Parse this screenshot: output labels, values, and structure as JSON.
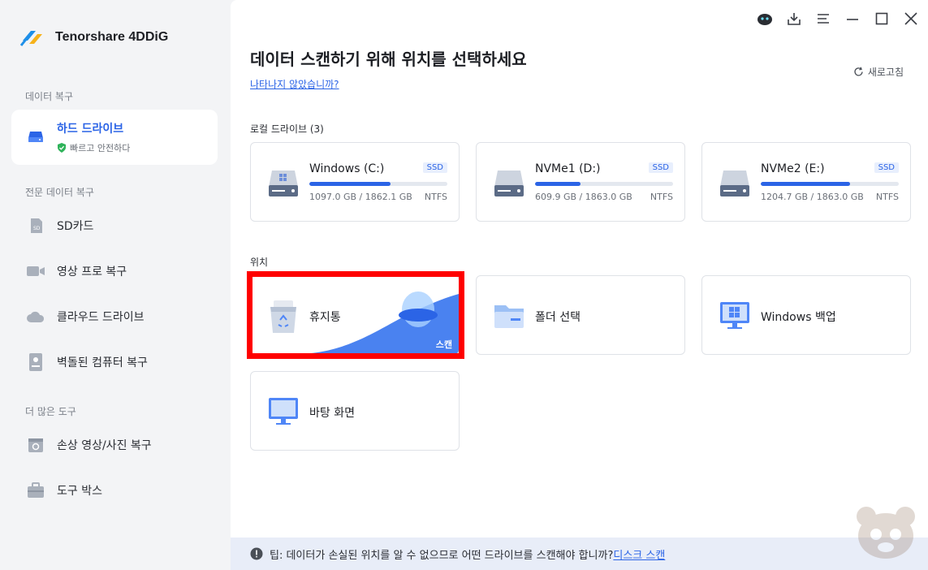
{
  "app": {
    "brand": "Tenorshare 4DDiG"
  },
  "sidebar": {
    "sections": [
      {
        "title": "데이터 복구"
      },
      {
        "title": "전문 데이터 복구"
      },
      {
        "title": "더 많은 도구"
      }
    ],
    "items": [
      {
        "label": "하드 드라이브",
        "sub": "빠르고 안전하다",
        "icon": "hard-drive-icon",
        "active": true
      },
      {
        "label": "SD카드",
        "icon": "sd-card-icon"
      },
      {
        "label": "영상 프로 복구",
        "icon": "video-camera-icon"
      },
      {
        "label": "클라우드 드라이브",
        "icon": "cloud-icon"
      },
      {
        "label": "벽돌된 컴퓨터 복구",
        "icon": "crashed-pc-icon"
      },
      {
        "label": "손상 영상/사진 복구",
        "icon": "photo-repair-icon"
      },
      {
        "label": "도구 박스",
        "icon": "toolbox-icon"
      }
    ]
  },
  "window_controls": [
    "assistant-icon",
    "download-icon",
    "menu-icon",
    "minimize-icon",
    "maximize-icon",
    "close-icon"
  ],
  "main": {
    "title": "데이터 스캔하기 위해 위치를 선택하세요",
    "help_link": "나타나지 않았습니까?",
    "refresh": "새로고침",
    "local_drives_label": "로컬 드라이브 (3)",
    "drives": [
      {
        "name": "Windows (C:)",
        "type": "SSD",
        "used": "1097.0 GB",
        "total": "1862.1 GB",
        "size_text": "1097.0 GB / 1862.1 GB",
        "fs": "NTFS",
        "usage": 0.589
      },
      {
        "name": "NVMe1 (D:)",
        "type": "SSD",
        "used": "609.9 GB",
        "total": "1863.0 GB",
        "size_text": "609.9 GB / 1863.0 GB",
        "fs": "NTFS",
        "usage": 0.327
      },
      {
        "name": "NVMe2 (E:)",
        "type": "SSD",
        "used": "1204.7 GB",
        "total": "1863.0 GB",
        "size_text": "1204.7 GB / 1863.0 GB",
        "fs": "NTFS",
        "usage": 0.647
      }
    ],
    "location_label": "위치",
    "locations": [
      {
        "label": "휴지통",
        "icon": "recycle-bin-icon",
        "scan_label": "스캔"
      },
      {
        "label": "폴더 선택",
        "icon": "folder-icon"
      },
      {
        "label": "Windows 백업",
        "icon": "windows-backup-icon"
      },
      {
        "label": "바탕 화면",
        "icon": "desktop-icon"
      }
    ]
  },
  "tip": {
    "text": "팁: 데이터가 손실된 위치를 알 수 없으므로 어떤 드라이브를 스캔해야 합니까?",
    "link": "디스크 스캔"
  },
  "colors": {
    "accent": "#2b64e6",
    "highlight": "#ff0000",
    "sidebar_bg": "#f3f4f6"
  }
}
